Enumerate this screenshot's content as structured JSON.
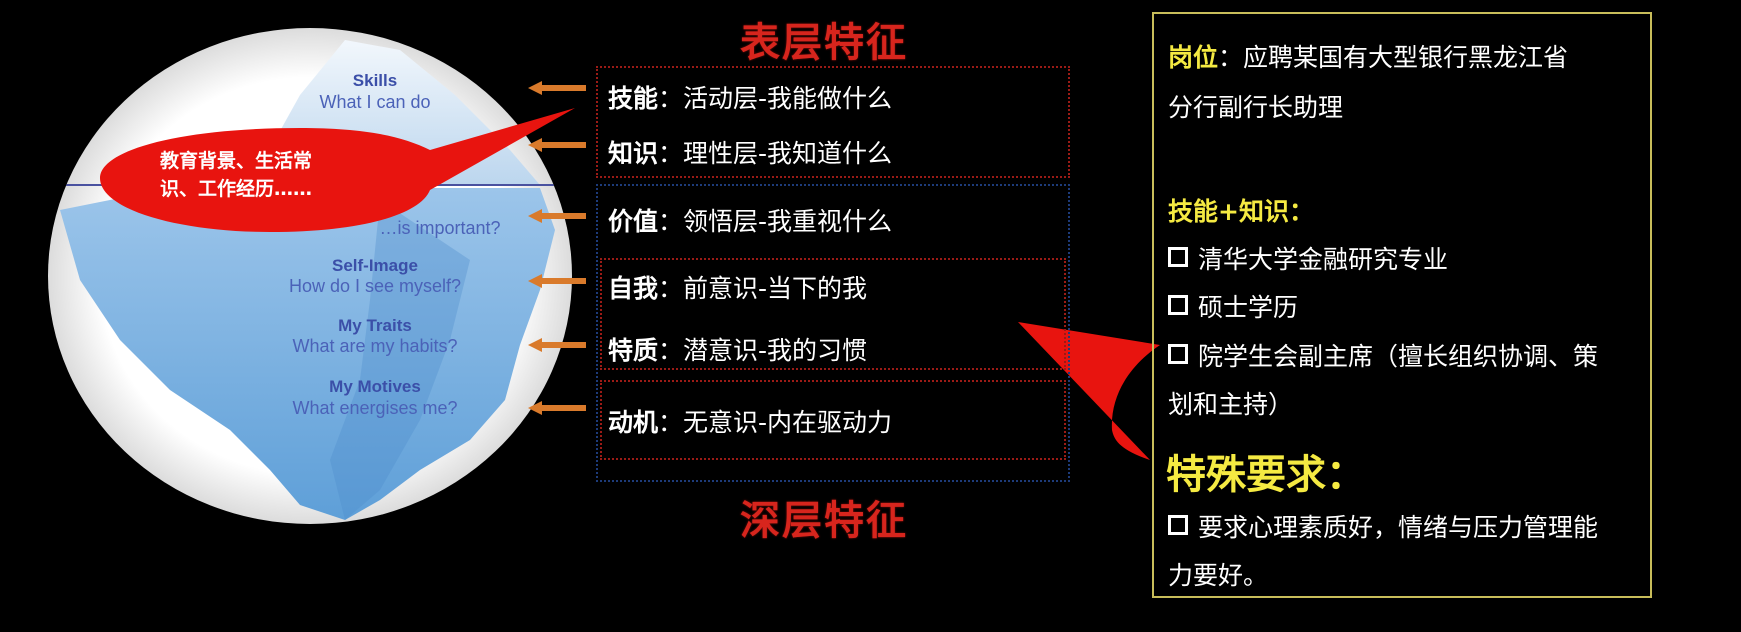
{
  "iceberg": {
    "skills_title": "Skills",
    "skills_sub": "What I can do",
    "values_sub": "…is important?",
    "selfimage_title": "Self-Image",
    "selfimage_sub": "How do I see myself?",
    "traits_title": "My Traits",
    "traits_sub": "What are my habits?",
    "motives_title": "My Motives",
    "motives_sub": "What energises me?"
  },
  "bubble": {
    "line1": "教育背景、生活常",
    "line2": "识、工作经历……"
  },
  "headings": {
    "surface": "表层特征",
    "deep": "深层特征"
  },
  "rows": [
    {
      "key": "技能",
      "text": "：活动层-我能做什么"
    },
    {
      "key": "知识",
      "text": "：理性层-我知道什么"
    },
    {
      "key": "价值",
      "text": "：领悟层-我重视什么"
    },
    {
      "key": "自我",
      "text": "：前意识-当下的我"
    },
    {
      "key": "特质",
      "text": "：潜意识-我的习惯"
    },
    {
      "key": "动机",
      "text": "：无意识-内在驱动力"
    }
  ],
  "panel": {
    "position_label": "岗位",
    "position_line1": "：应聘某国有大型银行黑龙江省",
    "position_line2": "分行副行长助理",
    "skills_heading": "技能+知识：",
    "items": [
      "清华大学金融研究专业",
      "硕士学历",
      "院学生会副主席（擅长组织协调、策"
    ],
    "item3_cont": "划和主持）",
    "special_heading": "特殊要求：",
    "special_item": "要求心理素质好，情绪与压力管理能",
    "special_cont": "力要好。"
  },
  "colors": {
    "heading_red": "#d7251d",
    "panel_yellow": "#f5ea42",
    "arrow_orange": "#d97a2b",
    "bubble_red": "#e8140f"
  }
}
